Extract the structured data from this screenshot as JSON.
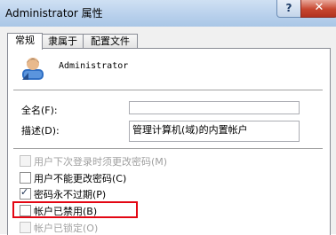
{
  "window": {
    "title": "Administrator 属性",
    "help_label": "?",
    "close_label": "✕"
  },
  "tabs": [
    {
      "label": "常规",
      "active": true
    },
    {
      "label": "隶属于",
      "active": false
    },
    {
      "label": "配置文件",
      "active": false
    }
  ],
  "user": {
    "name": "Administrator",
    "icon": "user-account-icon"
  },
  "form": {
    "full_name_label": "全名(F):",
    "full_name_value": "",
    "description_label": "描述(D):",
    "description_value": "管理计算机(域)的内置帐户"
  },
  "options": [
    {
      "label": "用户下次登录时须更改密码(M)",
      "checked": false,
      "enabled": false
    },
    {
      "label": "用户不能更改密码(C)",
      "checked": false,
      "enabled": true
    },
    {
      "label": "密码永不过期(P)",
      "checked": true,
      "enabled": true
    },
    {
      "label": "帐户已禁用(B)",
      "checked": false,
      "enabled": true,
      "highlighted": true
    },
    {
      "label": "帐户已锁定(O)",
      "checked": false,
      "enabled": false
    }
  ],
  "colors": {
    "highlight": "#e30613",
    "close_button": "#c7462f",
    "title_bar": "#b9d1ec"
  }
}
